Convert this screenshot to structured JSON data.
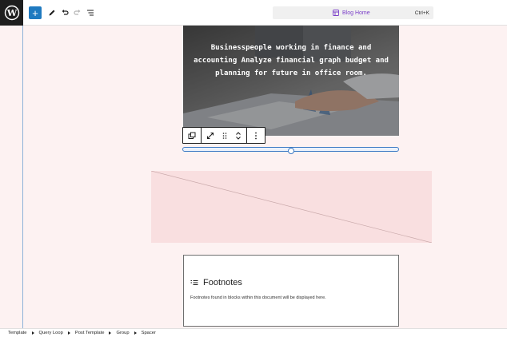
{
  "topbar": {
    "logo_icon": "wordpress-logo-icon",
    "add_icon": "plus-icon",
    "tools_icon": "pencil-icon",
    "undo_icon": "undo-icon",
    "redo_icon": "redo-icon",
    "outline_icon": "list-view-icon",
    "command": {
      "icon": "template-icon",
      "label": "Blog Home",
      "shortcut": "Ctrl+K"
    }
  },
  "cover": {
    "text": "Businesspeople working in finance and accounting Analyze financial graph budget and planning for future in office room."
  },
  "block_toolbar": {
    "icons": [
      "duplicate-icon",
      "expand-icon",
      "drag-handle-icon",
      "move-up-down-icon",
      "more-options-icon"
    ]
  },
  "footnotes": {
    "icon": "footnotes-list-icon",
    "title": "Footnotes",
    "description": "Footnotes found in blocks within this document will be displayed here."
  },
  "breadcrumb": {
    "items": [
      "Template",
      "Query Loop",
      "Post Template",
      "Group",
      "Spacer"
    ]
  },
  "colors": {
    "accent": "#1f7ac0",
    "canvas_bg": "#fdf2f2",
    "spacer_bg": "#f9dfe0",
    "command_accent": "#7b3fc9"
  }
}
